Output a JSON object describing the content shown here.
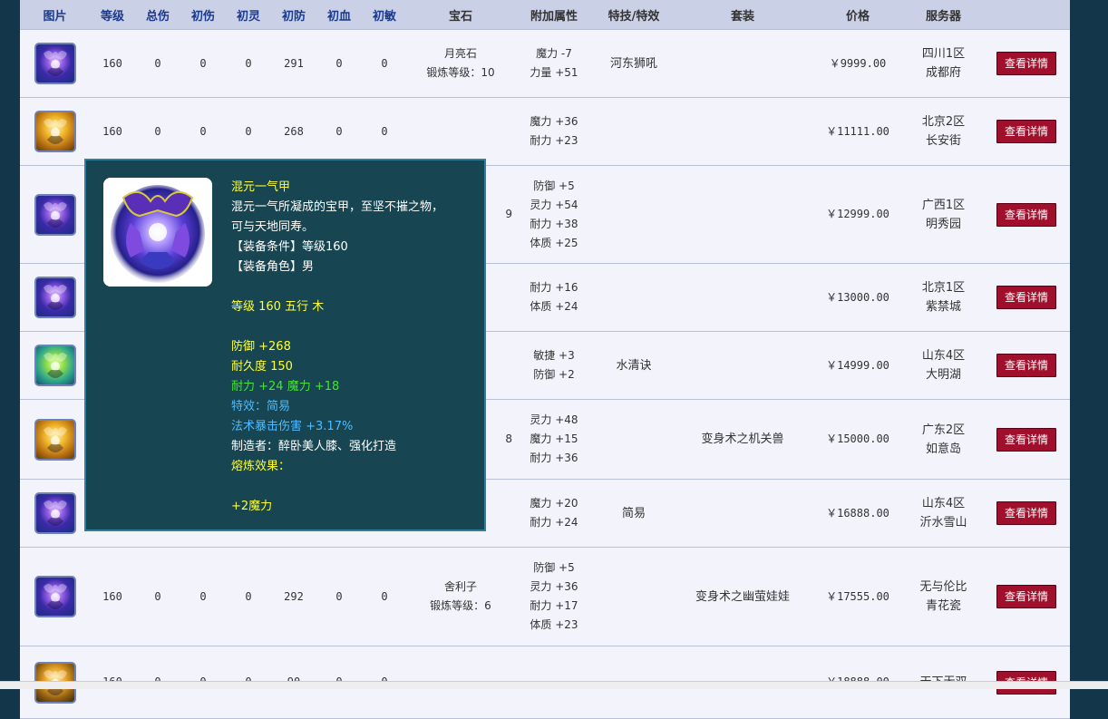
{
  "headers": [
    "图片",
    "等级",
    "总伤",
    "初伤",
    "初灵",
    "初防",
    "初血",
    "初敏",
    "宝石",
    "附加属性",
    "特技/特效",
    "套装",
    "价格",
    "服务器",
    ""
  ],
  "rows": [
    {
      "img": "purple",
      "level": "160",
      "total": "0",
      "dmg": "0",
      "spirit": "0",
      "def": "291",
      "hp": "0",
      "agi": "0",
      "gem": [
        "月亮石",
        "锻炼等级：10"
      ],
      "attrs": [
        "魔力 -7",
        "力量 +51"
      ],
      "skill": "河东狮吼",
      "set": "",
      "price": "￥9999.00",
      "price_color": "green",
      "server": [
        "四川1区",
        "成都府"
      ],
      "btn": "查看详情"
    },
    {
      "img": "gold",
      "level": "160",
      "total": "0",
      "dmg": "0",
      "spirit": "0",
      "def": "268",
      "hp": "0",
      "agi": "0",
      "gem": [],
      "attrs": [
        "魔力 +36",
        "耐力 +23"
      ],
      "skill": "",
      "set": "",
      "price": "￥11111.00",
      "price_color": "red",
      "server": [
        "北京2区",
        "长安街"
      ],
      "btn": "查看详情"
    },
    {
      "img": "purple",
      "level": "",
      "total": "",
      "dmg": "",
      "spirit": "",
      "def": "",
      "hp": "",
      "agi": "",
      "gem": [
        "9"
      ],
      "attrs": [
        "防御 +5",
        "灵力 +54",
        "耐力 +38",
        "体质 +25"
      ],
      "skill": "",
      "set": "",
      "price": "￥12999.00",
      "price_color": "red",
      "server": [
        "广西1区",
        "明秀园"
      ],
      "btn": "查看详情"
    },
    {
      "img": "purple",
      "level": "",
      "total": "",
      "dmg": "",
      "spirit": "",
      "def": "",
      "hp": "",
      "agi": "",
      "gem": [],
      "attrs": [
        "耐力 +16",
        "体质 +24"
      ],
      "skill": "",
      "set": "",
      "price": "￥13000.00",
      "price_color": "red",
      "server": [
        "北京1区",
        "紫禁城"
      ],
      "btn": "查看详情"
    },
    {
      "img": "green",
      "level": "",
      "total": "",
      "dmg": "",
      "spirit": "",
      "def": "",
      "hp": "",
      "agi": "",
      "gem": [],
      "attrs": [
        "敏捷 +3",
        "防御 +2"
      ],
      "skill": "水清诀",
      "set": "",
      "price": "￥14999.00",
      "price_color": "red",
      "server": [
        "山东4区",
        "大明湖"
      ],
      "btn": "查看详情"
    },
    {
      "img": "gold",
      "level": "",
      "total": "",
      "dmg": "",
      "spirit": "",
      "def": "",
      "hp": "",
      "agi": "",
      "gem": [
        "8"
      ],
      "attrs": [
        "灵力 +48",
        "魔力 +15",
        "耐力 +36"
      ],
      "skill": "",
      "set": "变身术之机关兽",
      "price": "￥15000.00",
      "price_color": "red",
      "server": [
        "广东2区",
        "如意岛"
      ],
      "btn": "查看详情"
    },
    {
      "img": "purple",
      "level": "",
      "total": "",
      "dmg": "",
      "spirit": "",
      "def": "",
      "hp": "",
      "agi": "",
      "gem": [],
      "attrs": [
        "魔力 +20",
        "耐力 +24"
      ],
      "skill": "简易",
      "set": "",
      "price": "￥16888.00",
      "price_color": "red",
      "server": [
        "山东4区",
        "沂水雪山"
      ],
      "btn": "查看详情"
    },
    {
      "img": "purple",
      "level": "160",
      "total": "0",
      "dmg": "0",
      "spirit": "0",
      "def": "292",
      "hp": "0",
      "agi": "0",
      "gem": [
        "舍利子",
        "锻炼等级：6"
      ],
      "attrs": [
        "防御 +5",
        "灵力 +36",
        "耐力 +17",
        "体质 +23"
      ],
      "skill": "",
      "set": "变身术之幽萤娃娃",
      "price": "￥17555.00",
      "price_color": "red",
      "server": [
        "无与伦比",
        "青花瓷"
      ],
      "btn": "查看详情"
    },
    {
      "img": "dragon",
      "level": "160",
      "total": "0",
      "dmg": "0",
      "spirit": "0",
      "def": "90",
      "hp": "0",
      "agi": "0",
      "gem": [],
      "attrs": [],
      "skill": "",
      "set": "",
      "price": "￥18888.00",
      "price_color": "red",
      "server": [
        "天下无双",
        ""
      ],
      "btn": "查看详情"
    }
  ],
  "tooltip": {
    "name": "混元一气甲",
    "desc1": "混元一气所凝成的宝甲，至坚不摧之物，",
    "desc2": "可与天地同寿。",
    "req_level": "【装备条件】等级160",
    "req_role": "【装备角色】男",
    "level_line": "等级 160 五行 木",
    "defense": "防御 +268",
    "durability": "耐久度 150",
    "bonus": "耐力 +24 魔力 +18",
    "effect": "特效：简易",
    "crit": "法术暴击伤害 +3.17%",
    "maker": "制造者：醉卧美人膝、强化打造",
    "smelt_label": "熔炼效果：",
    "smelt_value": "+2魔力"
  },
  "colors": {
    "price_green": "#13a800",
    "price_red": "#e00000",
    "button": "#a0102c",
    "header_text": "#1c3a8c"
  }
}
